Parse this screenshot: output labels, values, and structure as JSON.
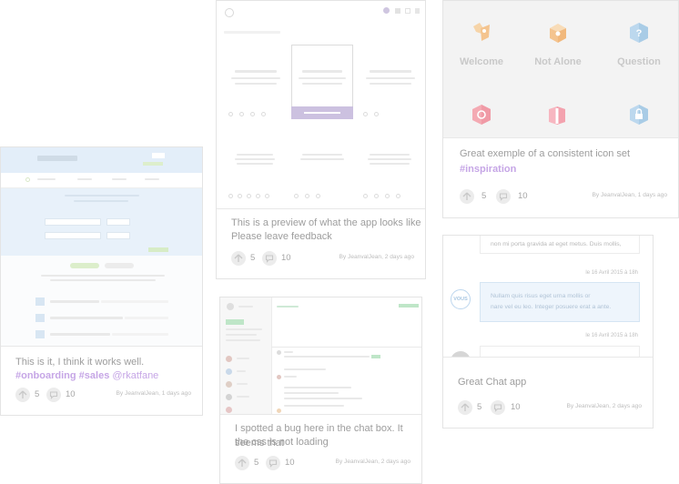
{
  "cards": {
    "dashboard": {
      "description": "This is it, I think it works well.",
      "tags": [
        "#onboarding",
        "#sales"
      ],
      "mention": "@rkatfane",
      "likes": "5",
      "comments": "10",
      "meta": "By JeanvalJean, 1 days ago"
    },
    "wireframe": {
      "description_line1": "This is a preview of what the app looks like",
      "description_line2": "Please leave feedback",
      "likes": "5",
      "comments": "10",
      "meta": "By JeanvalJean, 2 days ago"
    },
    "chatbug": {
      "description_line1": "I spotted a bug here in the chat box. It seems that",
      "description_line2": "the css is not loading",
      "likes": "5",
      "comments": "10",
      "meta": "By JeanvalJean, 2 days ago"
    },
    "icons": {
      "labels": [
        "Welcome",
        "Not Alone",
        "Question"
      ],
      "description": "Great exemple of a consistent icon set",
      "tag": "#inspiration",
      "likes": "5",
      "comments": "10",
      "meta": "By JeanvalJean, 1 days ago"
    },
    "chatapp": {
      "message1": "non mi porta gravida at eget metus. Duis mollis,",
      "time1": "le 16 Avril 2015 à 18h",
      "avatar_label": "VOUS",
      "message2_line1": "Nullam quis risus eget urna mollis or",
      "message2_line2": "nare vel eu leo. Integer posuere erat a ante.",
      "time2": "le 16 Avril 2015 à 18h",
      "description": "Great Chat app",
      "likes": "5",
      "comments": "10",
      "meta": "By JeanvalJean, 2 days ago"
    }
  },
  "colors": {
    "tag": "#c6a6e6",
    "accent_purple": "#ccc1e0",
    "dashboard_blue": "#e6f1fb",
    "chat_green": "#bfe6c8",
    "icon_orange": "#f4c48f",
    "icon_blue": "#a9cce6",
    "icon_pink": "#f09aa6"
  }
}
